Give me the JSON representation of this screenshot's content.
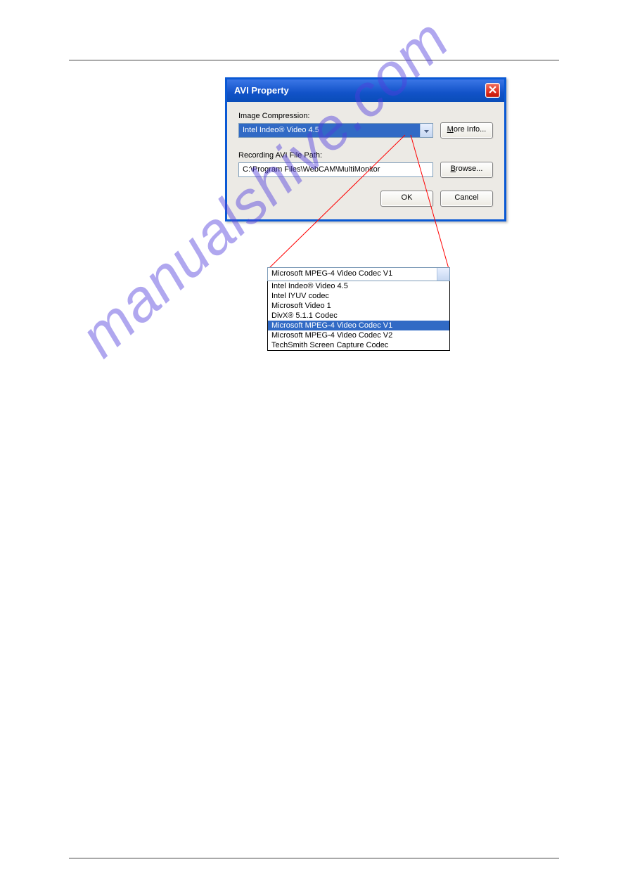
{
  "dialog": {
    "title": "AVI Property",
    "image_compression_label": "Image Compression:",
    "image_compression_value": "Intel Indeo® Video 4.5",
    "more_info_label_1": "M",
    "more_info_label_2": "ore Info...",
    "recording_path_label_1": "Recording ",
    "recording_path_label_2": "A",
    "recording_path_label_3": "VI File Path:",
    "recording_path_value": "C:\\Program Files\\WebCAM\\MultiMonitor",
    "browse_label_1": "B",
    "browse_label_2": "rowse...",
    "ok_label": "OK",
    "cancel_label": "Cancel"
  },
  "dropdown": {
    "visible_value": "Microsoft MPEG-4 Video Codec V1",
    "options": [
      "Intel Indeo® Video 4.5",
      "Intel IYUV codec",
      "Microsoft Video 1",
      "DivX® 5.1.1 Codec",
      "Microsoft MPEG-4 Video Codec V1",
      "Microsoft MPEG-4 Video Codec V2",
      "TechSmith Screen Capture Codec"
    ],
    "selected_index": 4
  },
  "watermark": "manualshive.com"
}
